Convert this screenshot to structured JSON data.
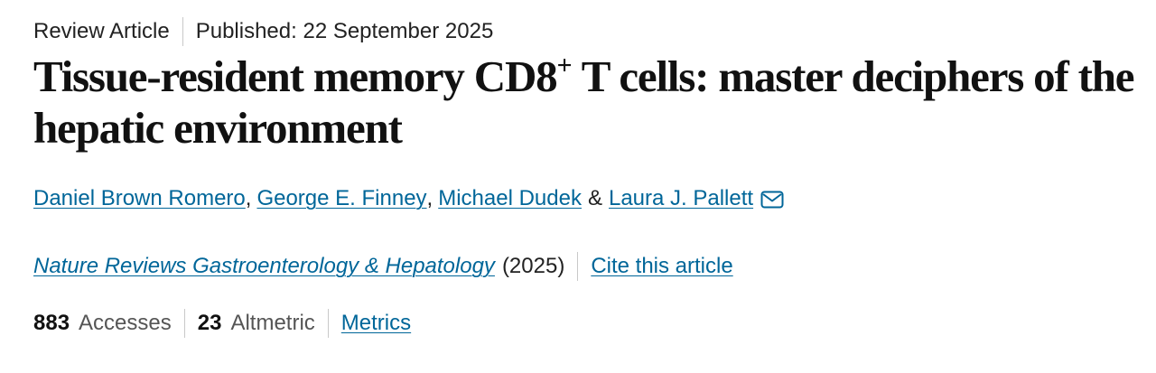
{
  "meta": {
    "article_type": "Review Article",
    "published": "Published: 22 September 2025"
  },
  "title": {
    "part1": "Tissue-resident memory CD8",
    "superscript": "+",
    "part2": " T cells: master deciphers of the hepatic environment"
  },
  "authors": {
    "list": [
      "Daniel Brown Romero",
      "George E. Finney",
      "Michael Dudek",
      "Laura J. Pallett"
    ],
    "comma": ",",
    "ampersand": "&",
    "icon": "mail-icon"
  },
  "journal": {
    "name": "Nature Reviews Gastroenterology & Hepatology",
    "year": "(2025)",
    "cite_link": "Cite this article"
  },
  "metrics": {
    "accesses_count": "883",
    "accesses_label": "Accesses",
    "altmetric_count": "23",
    "altmetric_label": "Altmetric",
    "metrics_link": "Metrics"
  },
  "colors": {
    "link": "#006699",
    "text": "#222222",
    "separator": "#c9c9c9"
  }
}
